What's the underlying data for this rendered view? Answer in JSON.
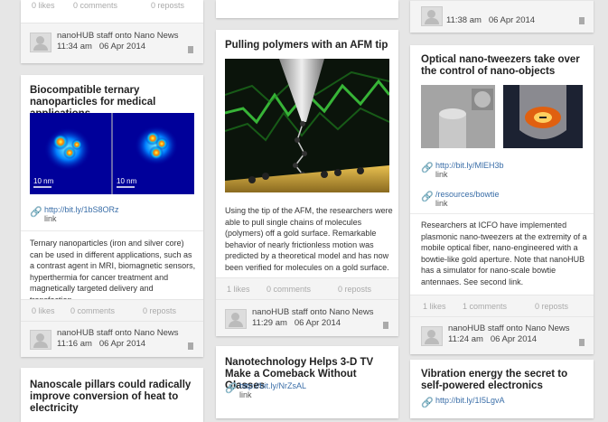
{
  "col1": {
    "top_stats": {
      "likes": "0 likes",
      "comments": "0 comments",
      "reposts": "0 reposts"
    },
    "top_footer": {
      "user": "nanoHUB staff",
      "onto": " onto ",
      "board": "Nano News",
      "time": "11:34 am",
      "date": "06 Apr 2014"
    },
    "card2": {
      "title": "Biocompatible ternary nanoparticles for medical applications",
      "scale_left": "10 nm",
      "scale_right": "10 nm",
      "link_url": "http://bit.ly/1bS8ORz",
      "link_label": "link",
      "body": "Ternary nanoparticles (iron and silver core) can be used in different applications, such as a contrast agent in MRI, biomagnetic sensors, hyperthermia for cancer treatment and magnetically targeted delivery and transfection.",
      "stats": {
        "likes": "0 likes",
        "comments": "0 comments",
        "reposts": "0 reposts"
      },
      "footer": {
        "user": "nanoHUB staff",
        "onto": " onto ",
        "board": "Nano News",
        "time": "11:16 am",
        "date": "06 Apr 2014"
      }
    },
    "card3": {
      "title": "Nanoscale pillars could radically improve conversion of heat to electricity"
    }
  },
  "col2": {
    "card1": {
      "title": "Pulling polymers with an AFM tip",
      "body": "Using the tip of the AFM, the researchers were able to pull single chains of molecules (polymers) off a gold surface. Remarkable behavior of nearly frictionless motion was predicted by a theoretical model and has now been verified for molecules on a gold surface.",
      "stats": {
        "likes": "1 likes",
        "comments": "0 comments",
        "reposts": "0 reposts"
      },
      "footer": {
        "user": "nanoHUB staff",
        "onto": " onto ",
        "board": "Nano News",
        "time": "11:29 am",
        "date": "06 Apr 2014"
      }
    },
    "card2": {
      "title": "Nanotechnology Helps 3-D TV Make a Comeback Without Glasses",
      "link_url": "http://bit.ly/NrZsAL",
      "link_label": "link"
    }
  },
  "col3": {
    "top_footer": {
      "time": "11:38 am",
      "date": "06 Apr 2014"
    },
    "card1": {
      "title": "Optical nano-tweezers take over the control of nano-objects",
      "link1_url": "http://bit.ly/MlEH3b",
      "link1_label": "link",
      "link2_url": "/resources/bowtie",
      "link2_label": "link",
      "body": "Researchers at ICFO have implemented plasmonic nano-tweezers at the extremity of a mobile optical fiber, nano-engineered with a bowtie-like gold aperture. Note that nanoHUB has a simulator for nano-scale bowtie antennaes. See second link.",
      "stats": {
        "likes": "1 likes",
        "comments": "1 comments",
        "reposts": "0 reposts"
      },
      "footer": {
        "user": "nanoHUB staff",
        "onto": " onto ",
        "board": "Nano News",
        "time": "11:24 am",
        "date": "06 Apr 2014"
      }
    },
    "card2": {
      "title": "Vibration energy the secret to self-powered electronics",
      "link_url": "http://bit.ly/1I5LgvA"
    }
  },
  "colors": {
    "link": "#3a6ea8",
    "background": "#e6e6e6",
    "footer": "#f4f4f4"
  }
}
